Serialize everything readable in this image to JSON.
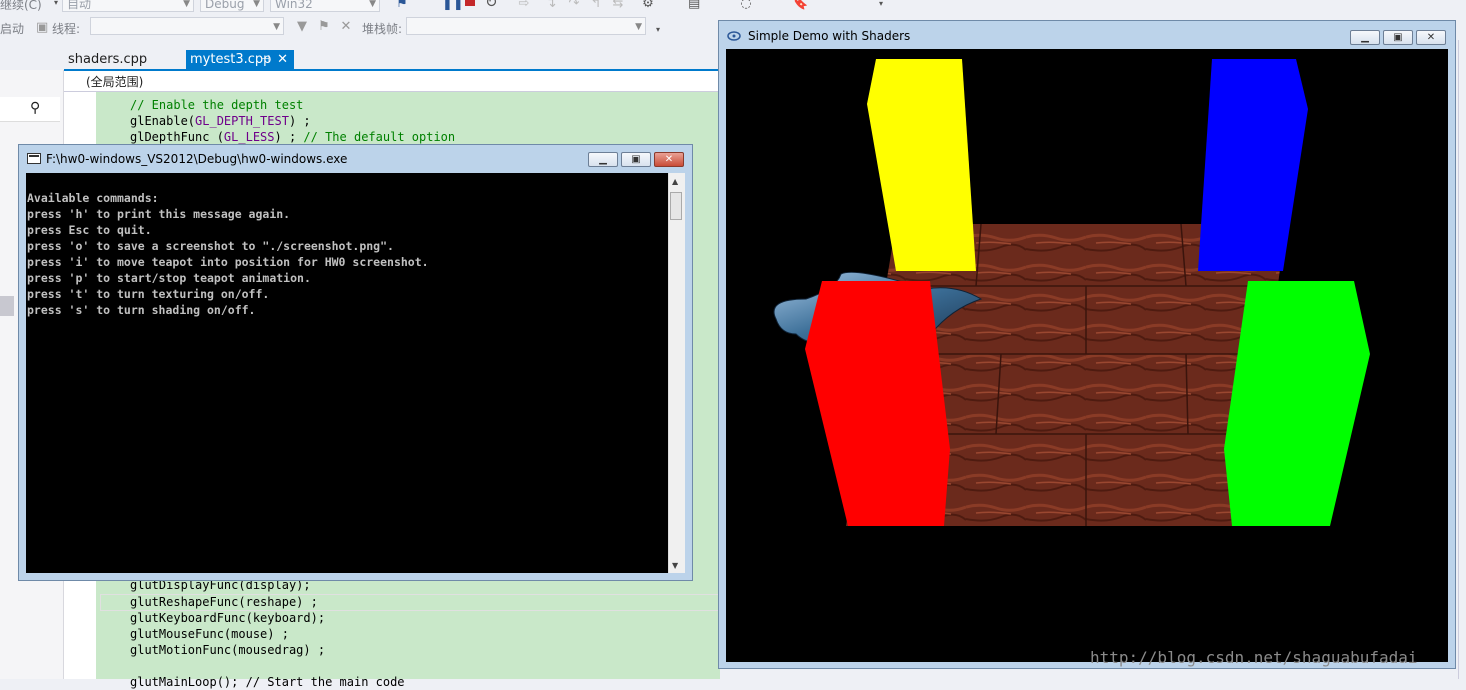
{
  "toolbar": {
    "continue_label": "继续(C)",
    "process_combo": "自动",
    "config_combo": "Debug",
    "platform_combo": "Win32",
    "launch_label": "启动",
    "thread_label": "线程:",
    "stackframe_label": "堆栈帧:"
  },
  "editor": {
    "tabs": [
      {
        "label": "shaders.cpp",
        "active": false
      },
      {
        "label": "mytest3.cpp",
        "active": true
      }
    ],
    "scope": "(全局范围)",
    "code_top": [
      {
        "text": "// Enable the depth test",
        "kind": "comment"
      },
      {
        "text": "glEnable(GL_DEPTH_TEST) ;",
        "kind": "code"
      },
      {
        "text": "glDepthFunc (GL_LESS) ; // The default option",
        "kind": "code"
      }
    ],
    "code_bottom": [
      "glutDisplayFunc(display);",
      "glutReshapeFunc(reshape) ;",
      "glutKeyboardFunc(keyboard);",
      "glutMouseFunc(mouse) ;",
      "glutMotionFunc(mousedrag) ;",
      "",
      "glutMainLoop(); // Start the main code"
    ]
  },
  "console": {
    "title": "F:\\hw0-windows_VS2012\\Debug\\hw0-windows.exe",
    "lines": [
      "Available commands:",
      "press 'h' to print this message again.",
      "press Esc to quit.",
      "press 'o' to save a screenshot to \"./screenshot.png\".",
      "press 'i' to move teapot into position for HW0 screenshot.",
      "press 'p' to start/stop teapot animation.",
      "press 't' to turn texturing on/off.",
      "press 's' to turn shading on/off."
    ]
  },
  "glwindow": {
    "title": "Simple Demo with Shaders",
    "watermark": "http://blog.csdn.net/shaguabufadai"
  },
  "scene_colors": {
    "yellow": "#ffff00",
    "blue": "#0000ff",
    "red": "#ff0000",
    "green": "#00ff00",
    "floor": "#6b2a1c",
    "accent": "#007acc"
  },
  "icons": {
    "search": "search-icon",
    "pin": "pin-icon",
    "close": "close-icon"
  }
}
